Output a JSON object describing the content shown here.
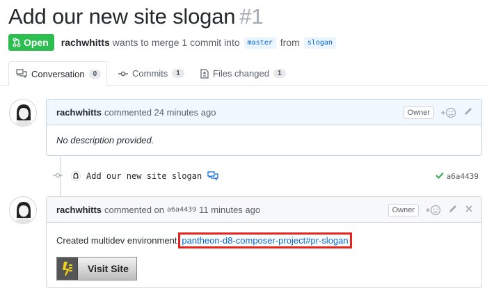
{
  "issue": {
    "title": "Add our new site slogan",
    "number": "#1",
    "state_label": "Open",
    "state_color": "#2cbe4e",
    "author": "rachwhitts",
    "merge_text": "wants to merge 1 commit into",
    "base_branch": "master",
    "from_text": "from",
    "head_branch": "slogan"
  },
  "tabs": [
    {
      "label": "Conversation",
      "count": "0",
      "icon": "conversation-icon",
      "active": true
    },
    {
      "label": "Commits",
      "count": "1",
      "icon": "commit-icon",
      "active": false
    },
    {
      "label": "Files changed",
      "count": "1",
      "icon": "file-diff-icon",
      "active": false
    }
  ],
  "comments": [
    {
      "author": "rachwhitts",
      "action": "commented 24 minutes ago",
      "badge": "Owner",
      "body": "No description provided."
    },
    {
      "author": "rachwhitts",
      "action_prefix": "commented on",
      "sha": "a6a4439",
      "action_suffix": "11 minutes ago",
      "badge": "Owner",
      "body_prefix": "Created multidev environment",
      "link_text": "pantheon-d8-composer-project#pr-slogan",
      "button_label": "Visit Site"
    }
  ],
  "commit": {
    "message": "Add our new site slogan",
    "sha": "a6a4439",
    "status_icon": "check-icon",
    "status_color": "#28a745"
  },
  "colors": {
    "highlight_border": "#e8241d",
    "link": "#0366d6"
  }
}
